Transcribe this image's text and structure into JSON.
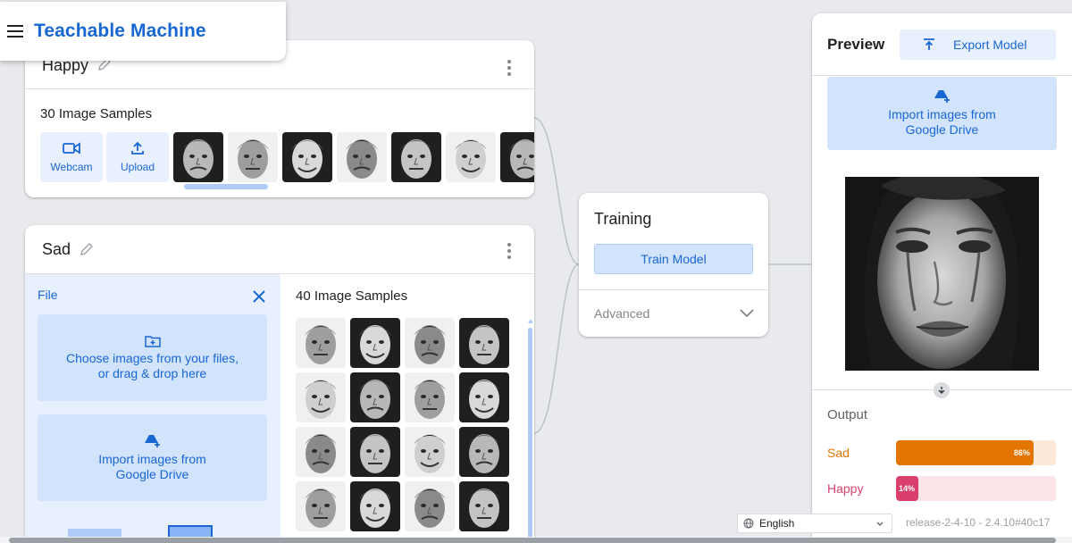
{
  "app": {
    "brand": "Teachable Machine"
  },
  "classes": [
    {
      "name": "Happy",
      "samples_label": "30 Image Samples",
      "webcam_label": "Webcam",
      "upload_label": "Upload"
    },
    {
      "name": "Sad",
      "samples_label": "40 Image Samples",
      "file_title": "File",
      "choose_files_line1": "Choose images from your files,",
      "choose_files_line2": "or drag & drop here",
      "drive_line1": "Import images from",
      "drive_line2": "Google Drive"
    }
  ],
  "training": {
    "title": "Training",
    "train_button": "Train Model",
    "advanced_label": "Advanced"
  },
  "preview": {
    "title": "Preview",
    "export_button": "Export Model",
    "drive_line1": "Import images from",
    "drive_line2": "Google Drive",
    "output_title": "Output",
    "results": [
      {
        "label": "Sad",
        "value": 86,
        "value_text": "86%",
        "color": "#e37400",
        "track": "#fde9d9"
      },
      {
        "label": "Happy",
        "value": 14,
        "value_text": "14%",
        "color": "#d93f6c",
        "track": "#fce4e8"
      }
    ]
  },
  "footer": {
    "language": "English",
    "release": "release-2-4-10 - 2.4.10#40c17"
  },
  "colors": {
    "accent": "#1967d2",
    "accent_light": "#e8f0fe",
    "page_bg": "#e8eaed"
  },
  "icons": [
    "menu-icon",
    "pencil-icon",
    "more-vert-icon",
    "webcam-icon",
    "upload-icon",
    "close-icon",
    "folder-add-icon",
    "drive-add-icon",
    "export-icon",
    "chevron-down-icon",
    "arrow-down-icon",
    "globe-icon"
  ]
}
